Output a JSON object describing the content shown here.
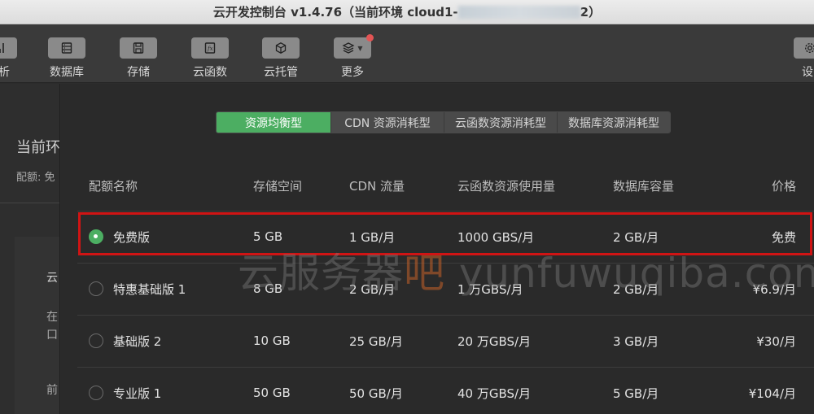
{
  "window": {
    "title_prefix": "云开发控制台 v1.4.76（当前环境 cloud1-",
    "title_suffix": "2）"
  },
  "toolbar": {
    "items": [
      {
        "label": "分析",
        "icon": "chart-icon"
      },
      {
        "label": "数据库",
        "icon": "database-icon"
      },
      {
        "label": "存储",
        "icon": "storage-icon"
      },
      {
        "label": "云函数",
        "icon": "function-icon"
      },
      {
        "label": "云托管",
        "icon": "container-icon"
      },
      {
        "label": "更多",
        "icon": "layers-icon"
      },
      {
        "label": "设",
        "icon": "gear-icon"
      }
    ]
  },
  "left_panel": {
    "heading": "当前环",
    "quota_line": "配额: 免",
    "item1": "云",
    "item2a": "在",
    "item2b": "口",
    "item3": "前"
  },
  "tabs": [
    {
      "label": "资源均衡型",
      "active": true
    },
    {
      "label": "CDN 资源消耗型",
      "active": false
    },
    {
      "label": "云函数资源消耗型",
      "active": false
    },
    {
      "label": "数据库资源消耗型",
      "active": false
    }
  ],
  "table": {
    "headers": [
      "配额名称",
      "存储空间",
      "CDN 流量",
      "云函数资源使用量",
      "数据库容量",
      "价格"
    ],
    "rows": [
      {
        "name": "免费版",
        "storage": "5 GB",
        "cdn": "1 GB/月",
        "func": "1000 GBS/月",
        "db": "2 GB/月",
        "price": "免费",
        "selected": true
      },
      {
        "name": "特惠基础版 1",
        "storage": "8 GB",
        "cdn": "2 GB/月",
        "func": "1 万GBS/月",
        "db": "2 GB/月",
        "price": "¥6.9/月",
        "selected": false
      },
      {
        "name": "基础版 2",
        "storage": "10 GB",
        "cdn": "25 GB/月",
        "func": "20 万GBS/月",
        "db": "3 GB/月",
        "price": "¥30/月",
        "selected": false
      },
      {
        "name": "专业版 1",
        "storage": "50 GB",
        "cdn": "50 GB/月",
        "func": "40 万GBS/月",
        "db": "5 GB/月",
        "price": "¥104/月",
        "selected": false
      }
    ]
  },
  "watermark": {
    "part1": "云服务器",
    "part2": "吧",
    "part3": " yunfuwuqiba.com"
  },
  "colors": {
    "accent_green": "#4cae62",
    "highlight_red": "#d01414",
    "notification_dot": "#e35454"
  }
}
